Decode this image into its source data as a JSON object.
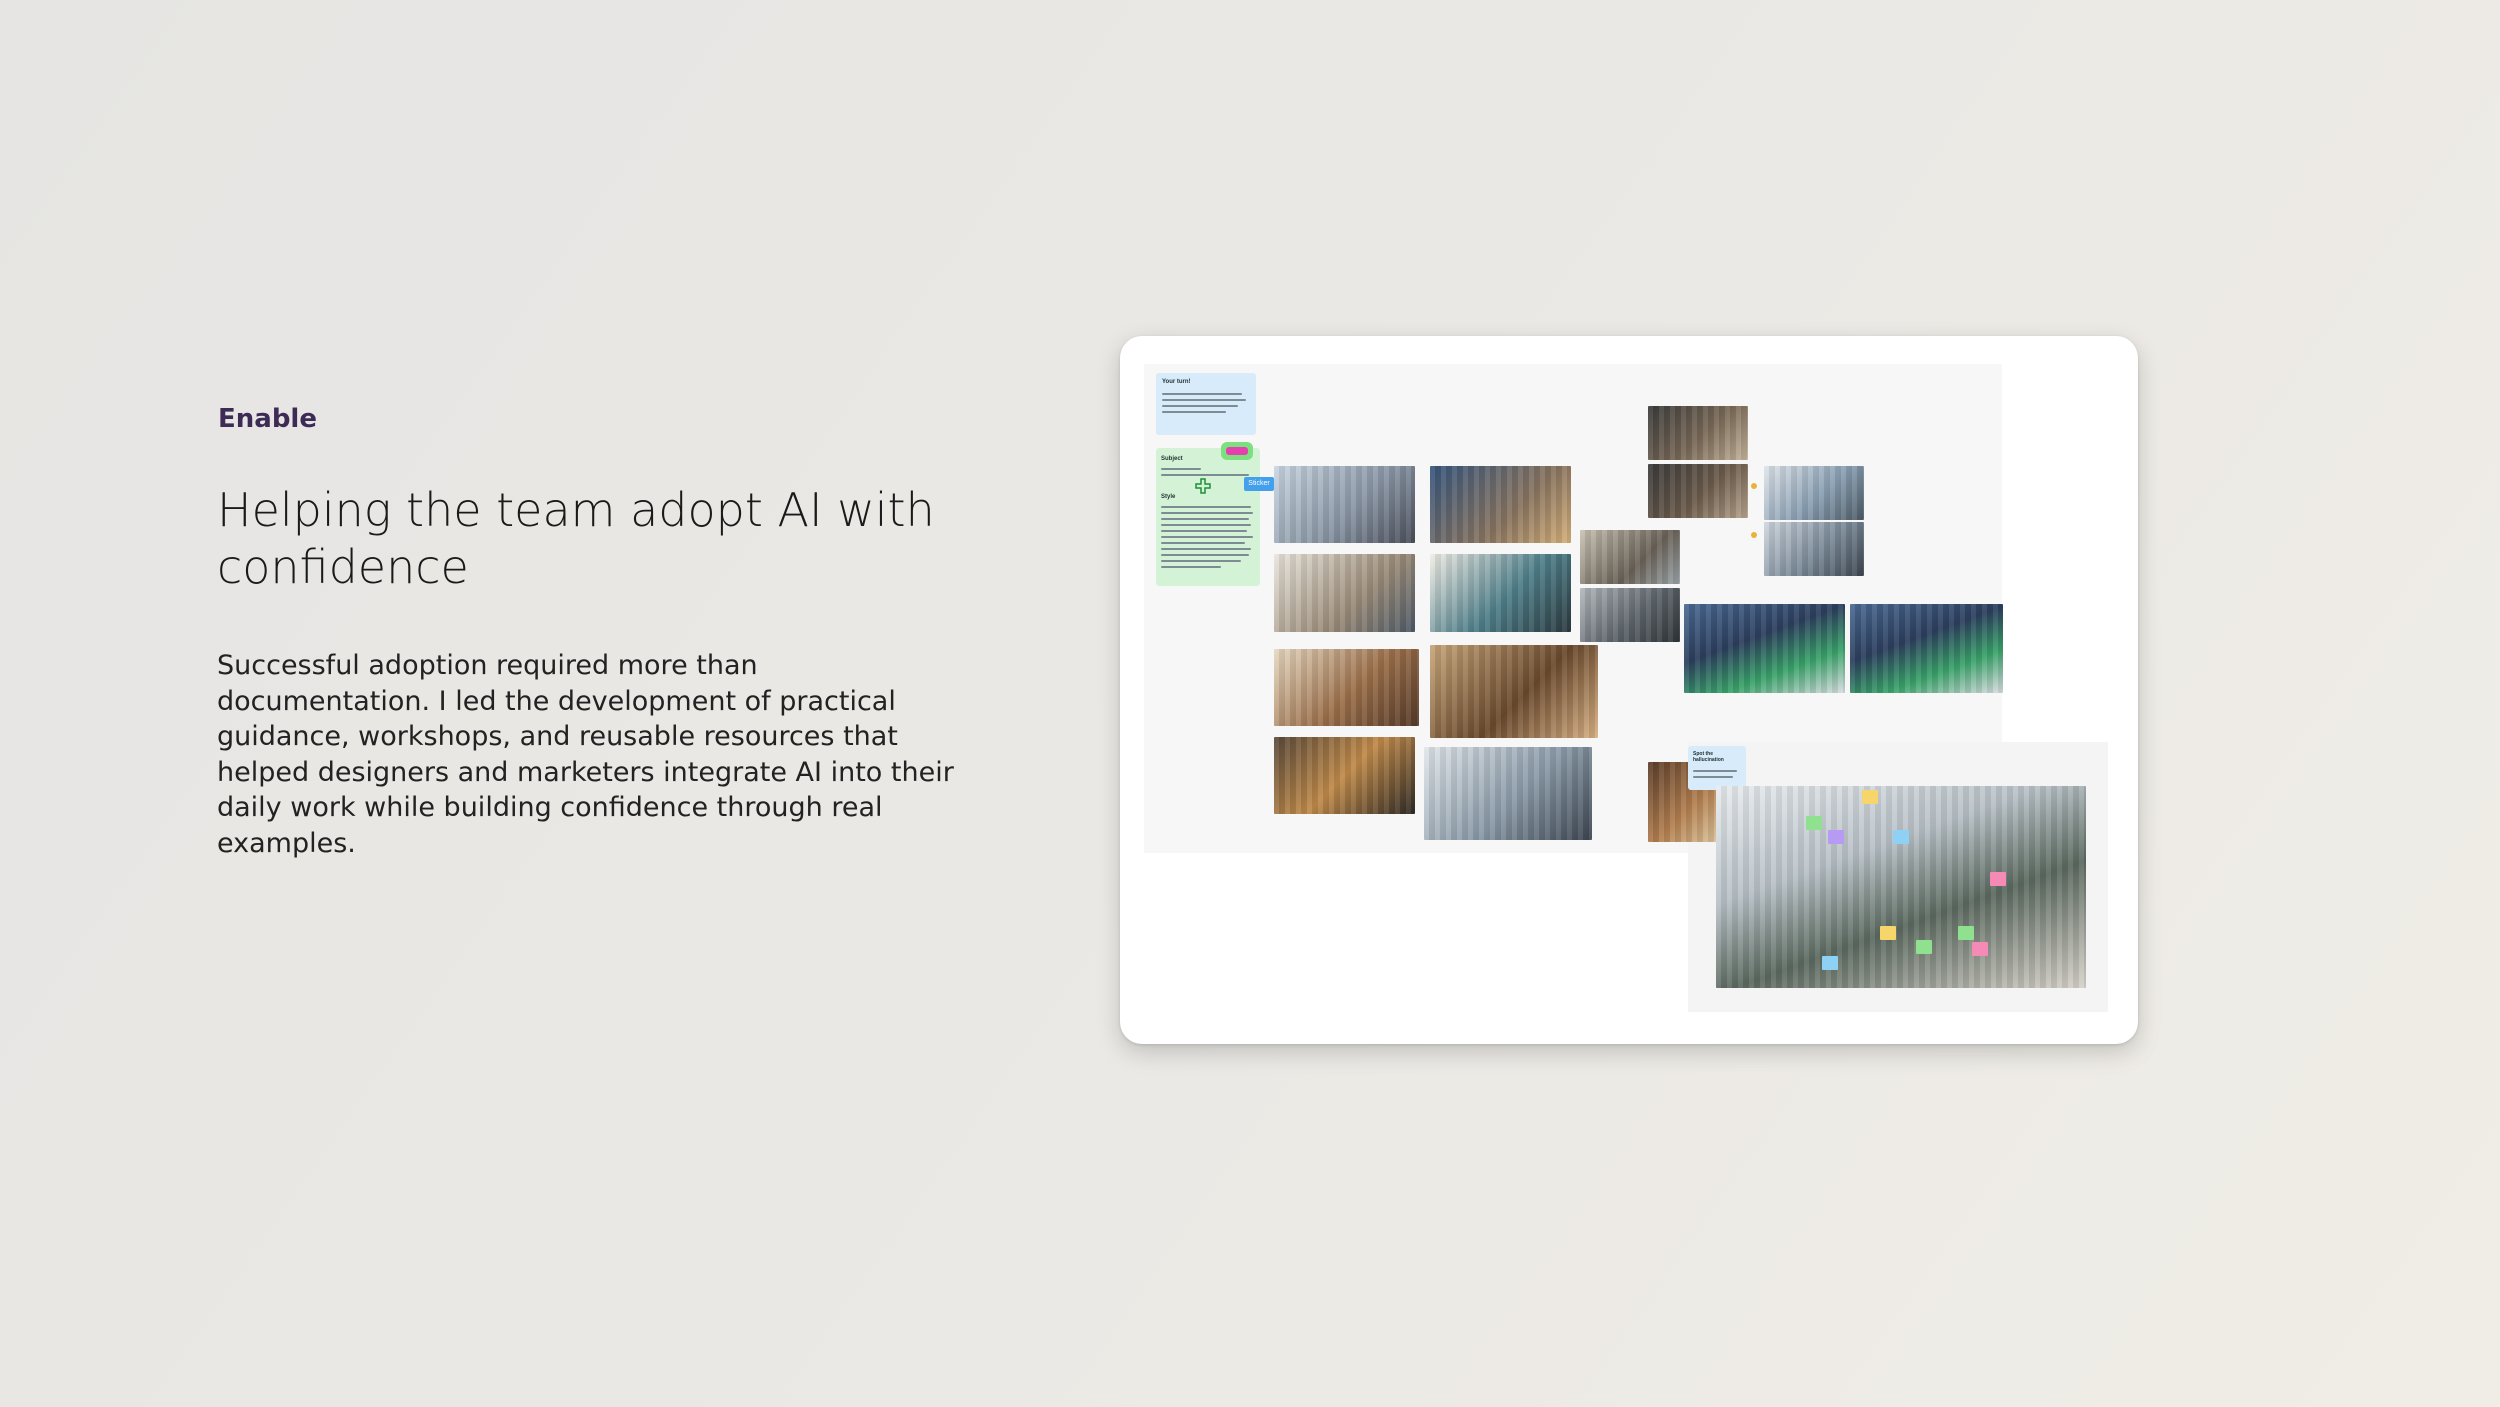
{
  "section": {
    "eyebrow": "Enable",
    "headline": "Helping the team adopt AI with confidence",
    "body": "Successful adoption required more than documentation. I led the development of practical guidance, workshops, and reusable resources that helped designers and marketers integrate AI into their daily work while building confidence through real examples."
  },
  "board": {
    "card_your_turn_title": "Your turn!",
    "card_subject_title": "Subject",
    "card_style_title": "Style",
    "chip_label": "Sticker",
    "card_spot_title": "Spot the hallucination"
  },
  "colors": {
    "eyebrow": "#3d2b55",
    "text": "#1a1a1a",
    "accent_blue_card": "#d7ebfb",
    "accent_green_card": "#d4f3d6"
  }
}
